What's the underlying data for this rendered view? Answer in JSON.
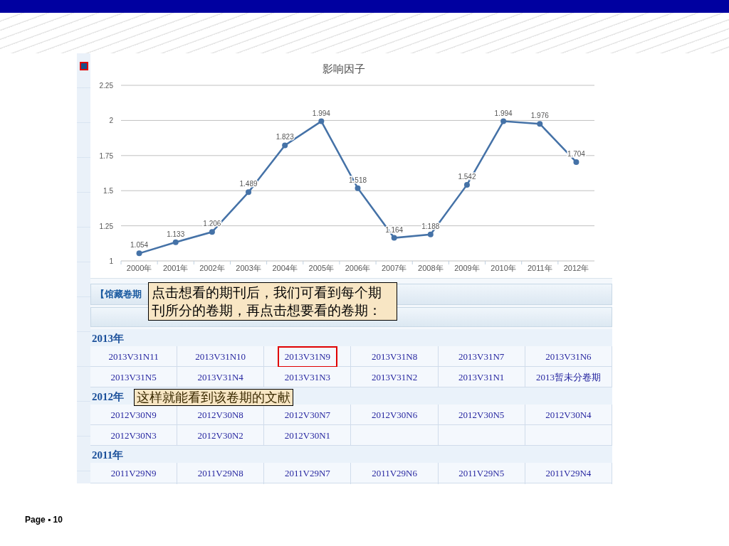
{
  "chart": {
    "title": "影响因子",
    "chart_data": {
      "type": "line",
      "categories": [
        "2000年",
        "2001年",
        "2002年",
        "2003年",
        "2004年",
        "2005年",
        "2006年",
        "2007年",
        "2008年",
        "2009年",
        "2010年",
        "2011年",
        "2012年"
      ],
      "values": [
        1.054,
        1.133,
        1.206,
        1.489,
        1.823,
        1.994,
        1.518,
        1.164,
        1.188,
        1.542,
        1.994,
        1.976,
        1.704
      ],
      "ylim": [
        1,
        2.25
      ],
      "yticks": [
        {
          "value": 1,
          "label": "1"
        },
        {
          "value": 1.25,
          "label": "1.25"
        },
        {
          "value": 1.5,
          "label": "1.5"
        },
        {
          "value": 1.75,
          "label": "1.75"
        },
        {
          "value": 2,
          "label": "2"
        },
        {
          "value": 2.25,
          "label": "2.25"
        }
      ],
      "grid": true,
      "marker": true,
      "data_labels": true
    }
  },
  "section_header": "【馆藏卷期",
  "years": [
    {
      "year": "2013年",
      "rows": [
        [
          {
            "text": "2013V31N11",
            "highlighted": false
          },
          {
            "text": "2013V31N10",
            "highlighted": false
          },
          {
            "text": "2013V31N9",
            "highlighted": true
          },
          {
            "text": "2013V31N8",
            "highlighted": false
          },
          {
            "text": "2013V31N7",
            "highlighted": false
          },
          {
            "text": "2013V31N6",
            "highlighted": false
          }
        ],
        [
          {
            "text": "2013V31N5",
            "highlighted": false
          },
          {
            "text": "2013V31N4",
            "highlighted": false
          },
          {
            "text": "2013V31N3",
            "highlighted": false
          },
          {
            "text": "2013V31N2",
            "highlighted": false
          },
          {
            "text": "2013V31N1",
            "highlighted": false
          },
          {
            "text": "2013暂未分卷期",
            "highlighted": false
          }
        ]
      ]
    },
    {
      "year": "2012年",
      "rows": [
        [
          {
            "text": "2012V30N9",
            "highlighted": false
          },
          {
            "text": "2012V30N8",
            "highlighted": false
          },
          {
            "text": "2012V30N7",
            "highlighted": false
          },
          {
            "text": "2012V30N6",
            "highlighted": false
          },
          {
            "text": "2012V30N5",
            "highlighted": false
          },
          {
            "text": "2012V30N4",
            "highlighted": false
          }
        ],
        [
          {
            "text": "2012V30N3",
            "highlighted": false
          },
          {
            "text": "2012V30N2",
            "highlighted": false
          },
          {
            "text": "2012V30N1",
            "highlighted": false
          }
        ]
      ]
    },
    {
      "year": "2011年",
      "rows": [
        [
          {
            "text": "2011V29N9",
            "highlighted": false
          },
          {
            "text": "2011V29N8",
            "highlighted": false
          },
          {
            "text": "2011V29N7",
            "highlighted": false
          },
          {
            "text": "2011V29N6",
            "highlighted": false
          },
          {
            "text": "2011V29N5",
            "highlighted": false
          },
          {
            "text": "2011V29N4",
            "highlighted": false
          }
        ]
      ]
    }
  ],
  "callouts": [
    "点击想看的期刊后，我们可看到每个期刊所分的卷期，再点击想要看的卷期：",
    "这样就能看到该卷期的文献"
  ],
  "footer": "Page ▪ 10"
}
